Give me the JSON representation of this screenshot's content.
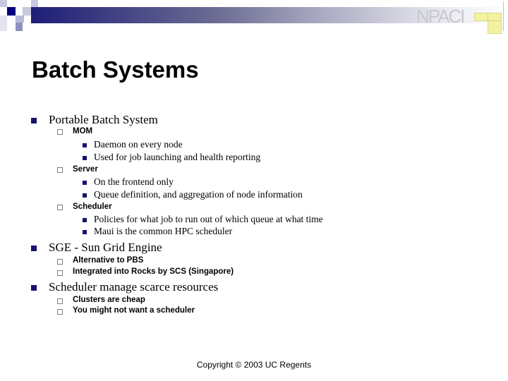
{
  "header": {
    "logo_text": "NPACI"
  },
  "slide": {
    "title": "Batch Systems",
    "bullets": [
      {
        "text": "Portable Batch System",
        "children": [
          {
            "text": "MOM",
            "children": [
              "Daemon on every node",
              "Used for job launching and health reporting"
            ]
          },
          {
            "text": "Server",
            "children": [
              "On the frontend only",
              "Queue definition, and aggregation of node information"
            ]
          },
          {
            "text": "Scheduler",
            "children": [
              "Policies for what job to run out of which queue at what time",
              "Maui is the common HPC scheduler"
            ]
          }
        ]
      },
      {
        "text": "SGE - Sun Grid Engine",
        "children": [
          {
            "text": "Alternative to PBS"
          },
          {
            "text": "Integrated into Rocks by SCS (Singapore)"
          }
        ]
      },
      {
        "text": "Scheduler manage scarce resources",
        "children": [
          {
            "text": "Clusters are cheap"
          },
          {
            "text": "You might not want a scheduler"
          }
        ]
      }
    ]
  },
  "footer": {
    "copyright": "Copyright © 2003 UC Regents"
  },
  "colors": {
    "bullet": "#14146e",
    "banner_start": "#1e1e78"
  }
}
